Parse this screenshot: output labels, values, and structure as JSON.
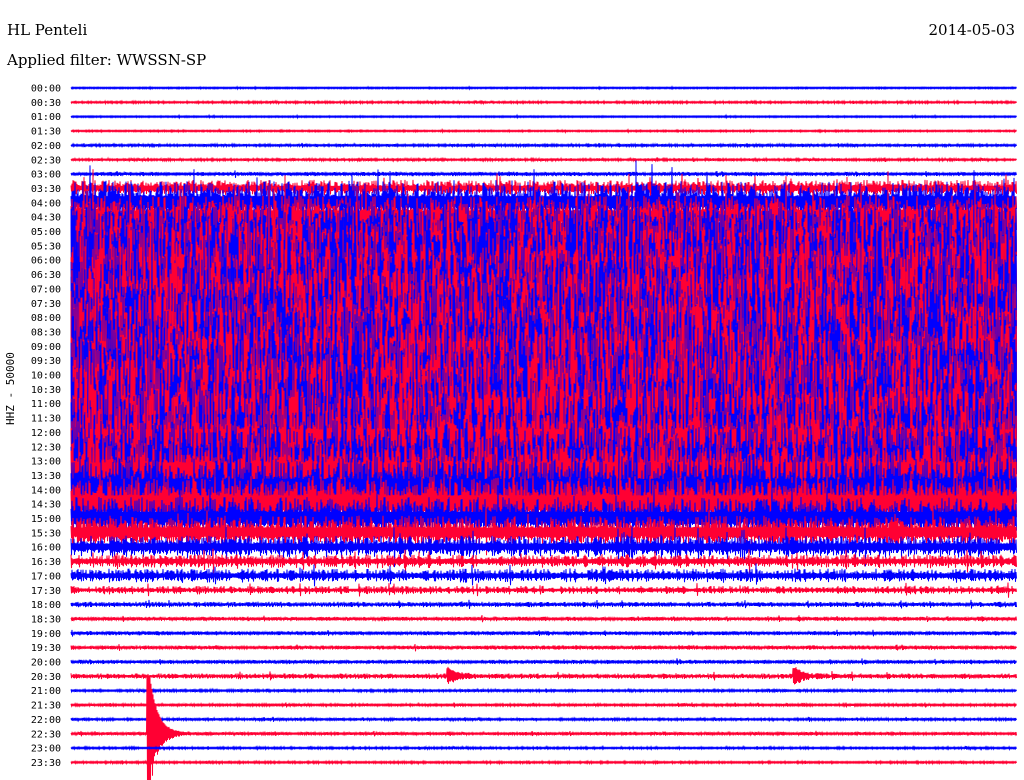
{
  "header": {
    "station": "HL Penteli",
    "filter": "Applied filter: WWSSN-SP",
    "date": "2014-05-03"
  },
  "chart_data": {
    "type": "line",
    "title": "HL Penteli",
    "subtitle": "Applied filter: WWSSN-SP",
    "date": "2014-05-03",
    "ylabel": "HHZ - 50000",
    "xlabel": "",
    "row_minutes": 30,
    "colors": {
      "even": "#0000ff",
      "odd": "#ff0033"
    },
    "rows": [
      "00:00",
      "00:30",
      "01:00",
      "01:30",
      "02:00",
      "02:30",
      "03:00",
      "03:30",
      "04:00",
      "04:30",
      "05:00",
      "05:30",
      "06:00",
      "06:30",
      "07:00",
      "07:30",
      "08:00",
      "08:30",
      "09:00",
      "09:30",
      "10:00",
      "10:30",
      "11:00",
      "11:30",
      "12:00",
      "12:30",
      "13:00",
      "13:30",
      "14:00",
      "14:30",
      "15:00",
      "15:30",
      "16:00",
      "16:30",
      "17:00",
      "17:30",
      "18:00",
      "18:30",
      "19:00",
      "19:30",
      "20:00",
      "20:30",
      "21:00",
      "21:30",
      "22:00",
      "22:30",
      "23:00",
      "23:30"
    ],
    "relative_amplitude": [
      0.05,
      0.08,
      0.05,
      0.06,
      0.1,
      0.1,
      0.15,
      0.6,
      1.5,
      1.5,
      2,
      3,
      4,
      4,
      4.5,
      4.5,
      4.5,
      4.5,
      4.5,
      4.5,
      4.5,
      4.5,
      4.5,
      4.5,
      4,
      4,
      3,
      3,
      2.5,
      2,
      1.5,
      1.2,
      0.8,
      0.5,
      0.5,
      0.3,
      0.2,
      0.15,
      0.15,
      0.15,
      0.15,
      0.2,
      0.1,
      0.1,
      0.1,
      0.12,
      0.08,
      0.08
    ],
    "events": [
      {
        "row": "22:30",
        "minute": 2.5,
        "relative_amplitude": 4
      },
      {
        "row": "20:30",
        "minute": 12,
        "relative_amplitude": 0.5
      },
      {
        "row": "20:30",
        "minute": 23,
        "relative_amplitude": 0.5
      }
    ]
  }
}
